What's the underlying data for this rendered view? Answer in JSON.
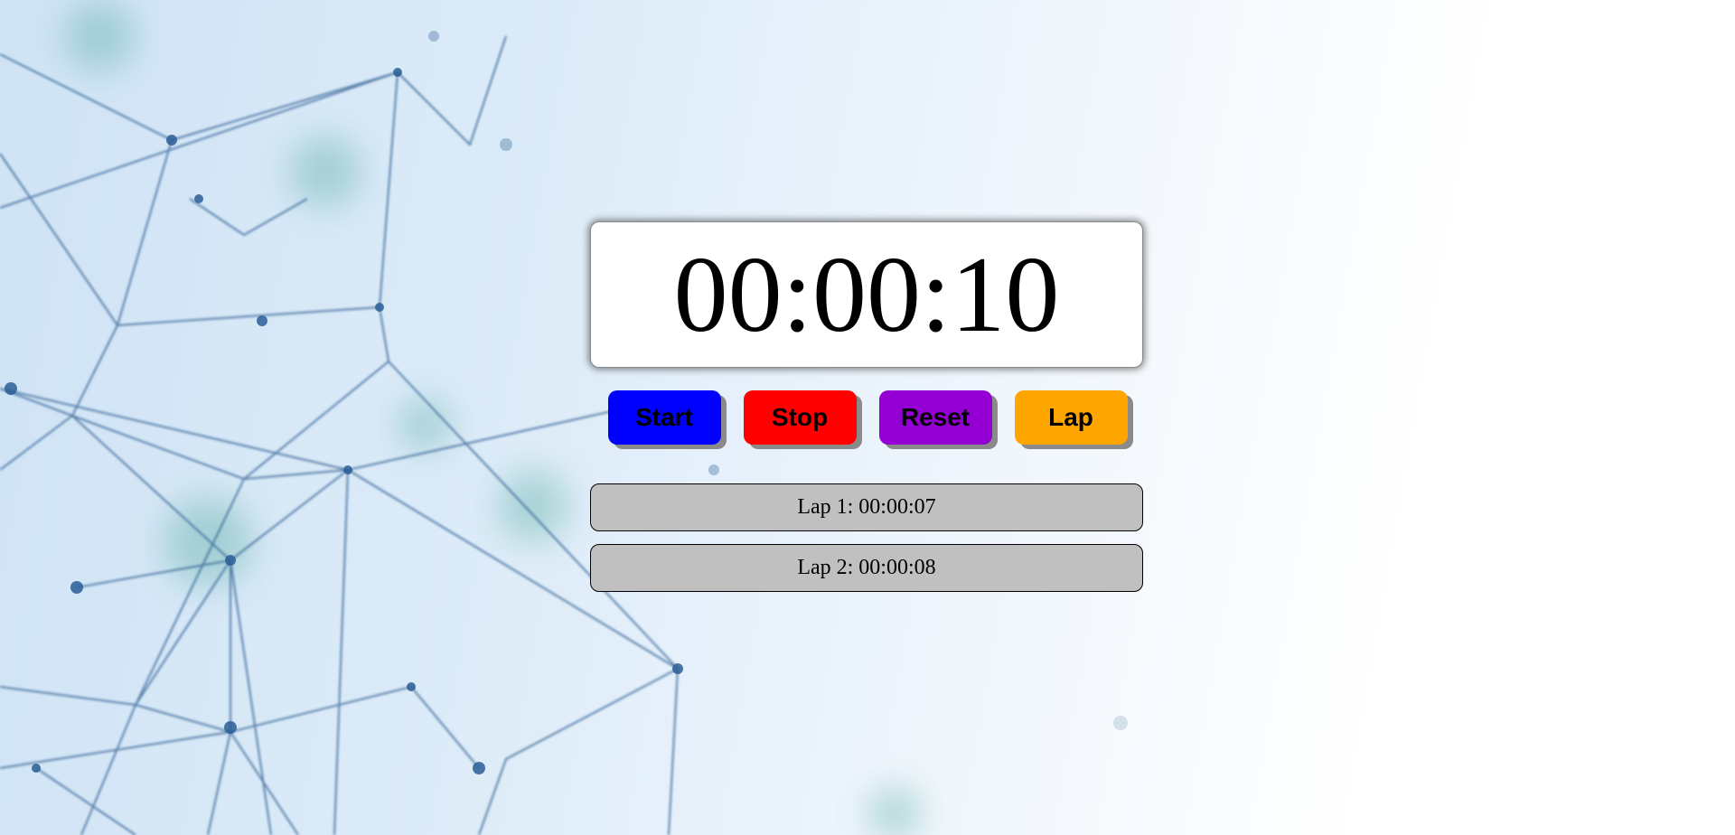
{
  "timer": {
    "display": "00:00:10"
  },
  "controls": {
    "start": {
      "label": "Start",
      "color": "#0000ff"
    },
    "stop": {
      "label": "Stop",
      "color": "#ff0000"
    },
    "reset": {
      "label": "Reset",
      "color": "#9400d3"
    },
    "lap": {
      "label": "Lap",
      "color": "#ffa500"
    }
  },
  "laps": [
    {
      "text": "Lap 1: 00:00:07"
    },
    {
      "text": "Lap 2: 00:00:08"
    }
  ],
  "background": {
    "description_icon": "network-graph-background"
  }
}
